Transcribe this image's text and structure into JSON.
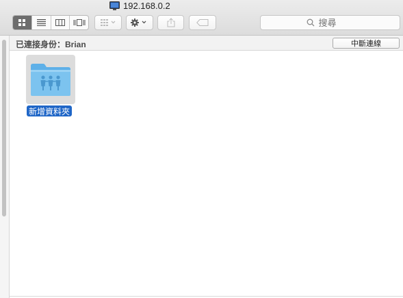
{
  "window": {
    "title": "192.168.0.2"
  },
  "toolbar": {
    "view_modes": [
      "icon",
      "list",
      "column",
      "cover-flow"
    ],
    "active_view": "icon"
  },
  "search": {
    "placeholder": "搜尋"
  },
  "connection": {
    "label": "已連接身份：Brian",
    "disconnect_label": "中斷連線"
  },
  "items": [
    {
      "name": "新增資料夾",
      "type": "shared-folder",
      "selected": true
    }
  ],
  "colors": {
    "selection": "#1f66c7",
    "folder": "#7cc3ef"
  }
}
